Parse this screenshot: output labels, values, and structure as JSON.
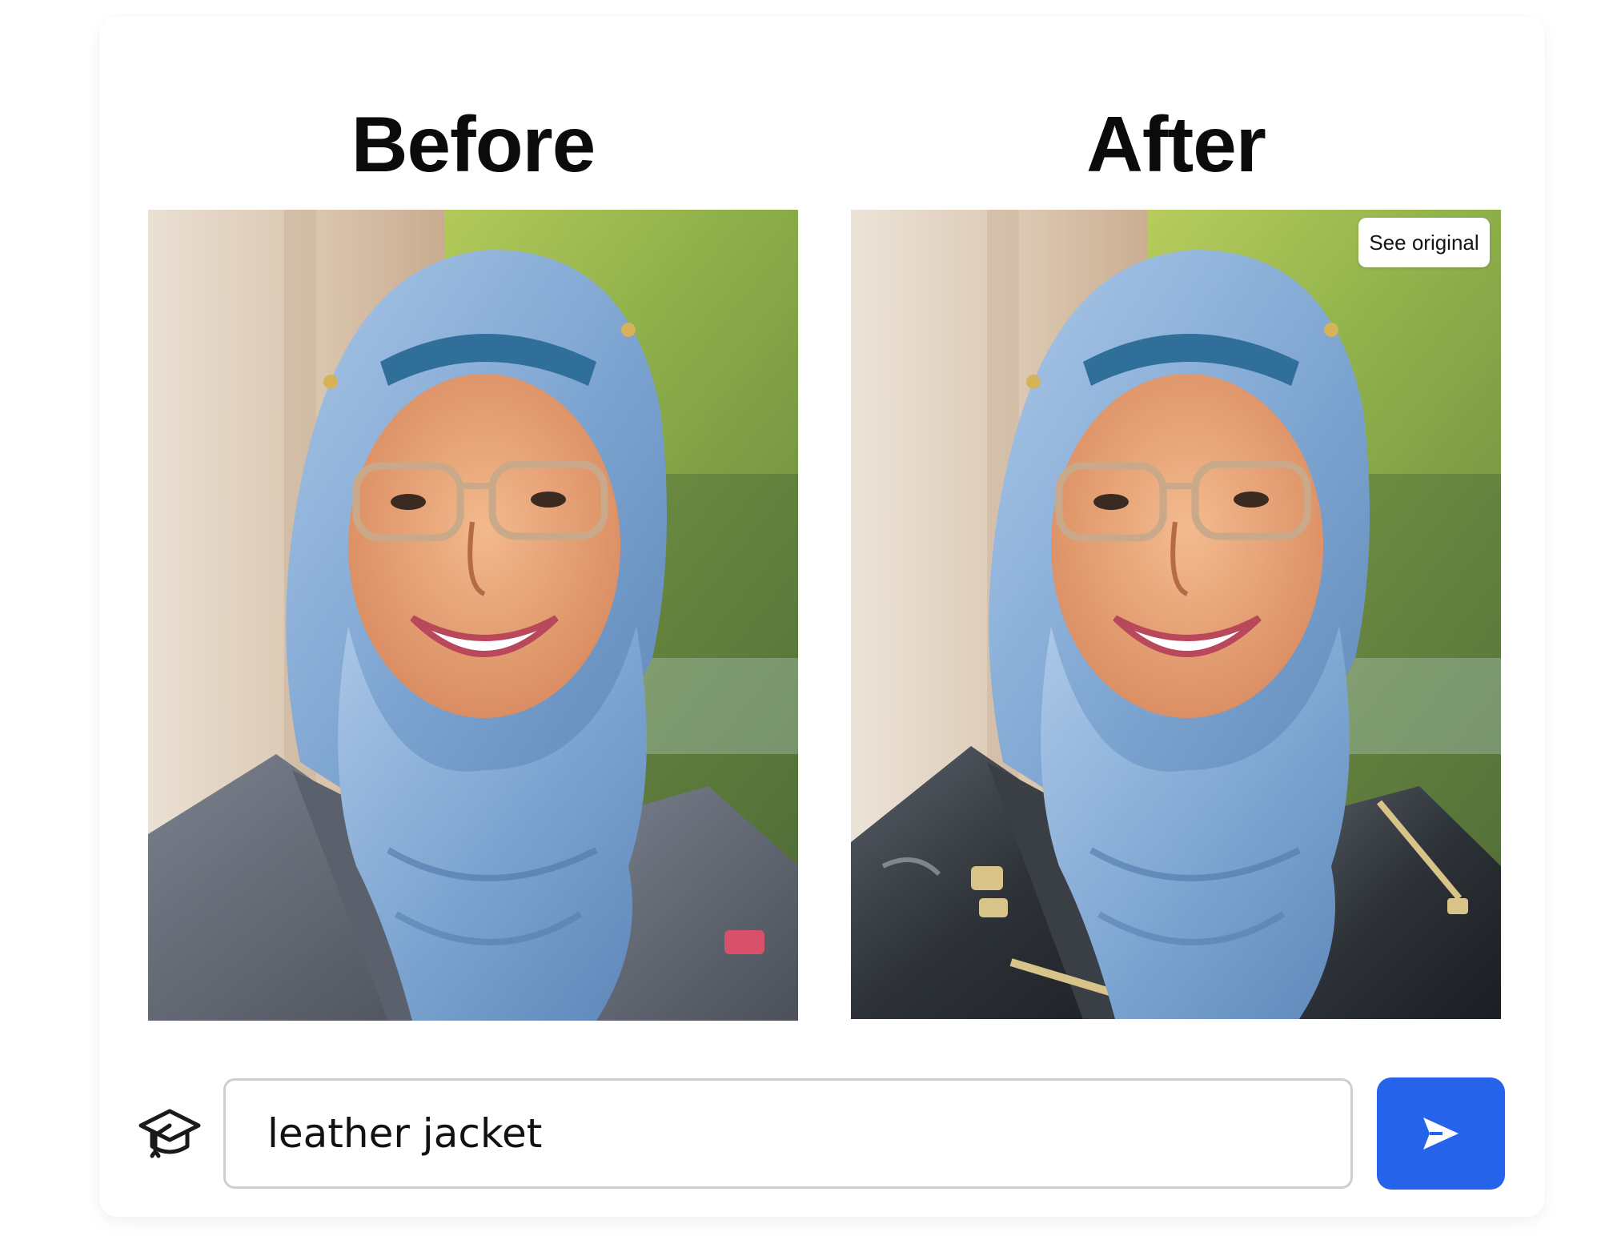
{
  "headings": {
    "before": "Before",
    "after": "After"
  },
  "after_panel": {
    "see_original_label": "See original"
  },
  "prompt": {
    "value": "leather jacket"
  },
  "icons": {
    "prompt_icon": "graduation-cap-icon",
    "send_icon": "send-arrow-icon"
  },
  "colors": {
    "send_button": "#2563eb",
    "input_border": "#cfcfcf"
  }
}
